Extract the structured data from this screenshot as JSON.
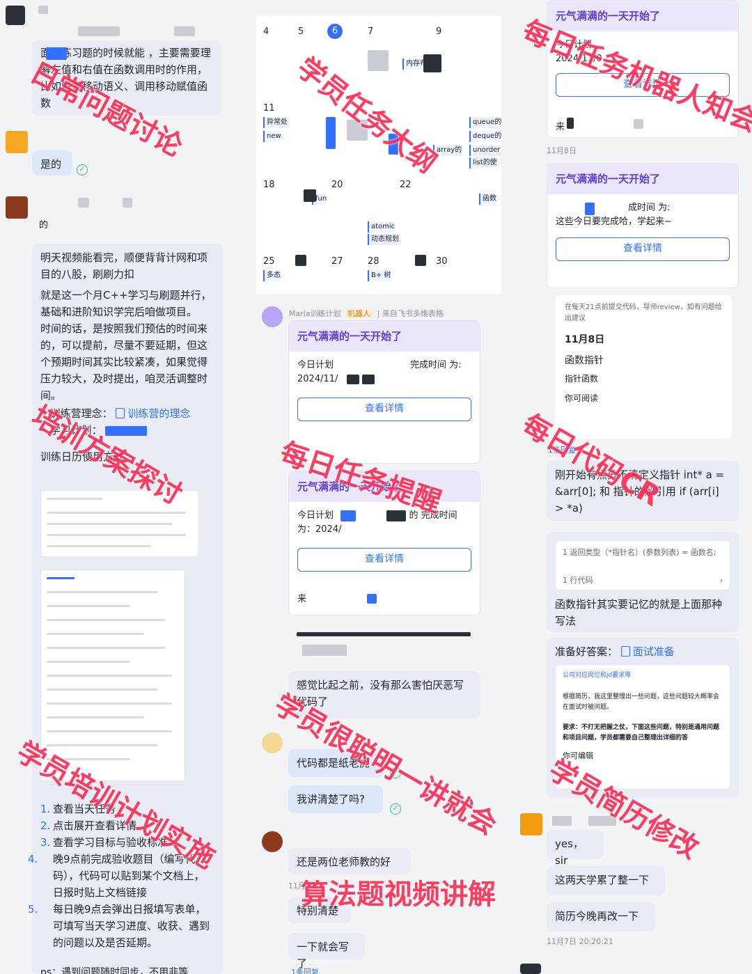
{
  "left": {
    "msg1": "面做练习题的时候就能 ，主要需要理解左值和右值在函数调用时的作用，比如触发移动语义、调用移动赋值函数",
    "msg2": "是的",
    "msg3_name": "的",
    "msg4_p1": "明天视频能看完，顺便背背计网和项目的八股，刷刷力扣",
    "msg4_p2": "就是这一个月C++学习与刷题并行，基础和进阶知识学完后咱做项目。",
    "msg4_p3": "时间的话，是按照我们预估的时间来的，可以提前，尽量不要延期，但这个预期时间其实比较紧凑，如果觉得压力较大，及时提出，咱灵活调整时间。",
    "bullet1_label": "训练营理念：",
    "bullet1_link": "训练营的理念",
    "bullet2_label": "学习计划：",
    "calendar_usage": "训练日历使用方式",
    "steps": [
      {
        "n": "1.",
        "text": "查看当天任务"
      },
      {
        "n": "2.",
        "text": "点击展开查看详情"
      },
      {
        "n": "3.",
        "text": "查看学习目标与验收标准"
      },
      {
        "n": "4.",
        "text": "晚9点前完成验收题目（编写代码），代码可以贴到某个文档上，日报时贴上文档链接"
      },
      {
        "n": "5.",
        "text": "每日晚9点会弹出日报填写表单，可填写当天学习进度、收获、遇到的问题以及是否延期。"
      }
    ],
    "footer": "ps：遇到问题随时同步，不用非等"
  },
  "calendar": {
    "days": [
      "4",
      "5",
      "6",
      "7",
      "9",
      "11",
      "18",
      "20",
      "22",
      "25",
      "27",
      "28",
      "30"
    ],
    "today": "6",
    "events": [
      "内存布",
      "queue的",
      "deque的",
      "unorder",
      "list的使",
      "异常处",
      "new",
      "array的",
      "fun",
      "atomic",
      "动态规划",
      "多态",
      "B+ 树",
      "函数"
    ]
  },
  "mid": {
    "bot_name": "Maria训练计划",
    "bot_tag": "机器人",
    "bot_source": "来自飞书多维表格",
    "card1_title": "元气满满的一天开始了",
    "card1_l1": "今日计划",
    "card1_l1b": "完成时间 为:",
    "card1_l2": "2024/11/",
    "card_btn": "查看详情",
    "card2_title": "元气满满的一天开始了",
    "card2_l1": "今日计划",
    "card2_l1b": "的 完成时间",
    "card2_l2": "为：2024/",
    "card2_l3": "来",
    "msg_a": "感觉比起之前，没有那么害怕厌恶写代码了",
    "msg_b": "代码都是纸老虎",
    "msg_c": "我讲清楚了吗?",
    "msg_d": "还是两位老师教的好",
    "msg_e": "特别清楚",
    "msg_f": "一下就会写了",
    "reply_count": "1条回复",
    "time_mid": "11月"
  },
  "right": {
    "card1_title": "元气满满的一天开始了",
    "card1_l1": "今日计划",
    "card1_l2": "2024/11/0",
    "card_btn": "查看详情",
    "card1_foot": "来",
    "time1": "11月8日",
    "card2_title": "元气满满的一天开始了",
    "card2_l1": "成时间 为:",
    "card2_l2": "这些今日要完成哈，学起来~",
    "doc_note": "在每天21点前提交代码，导师review，如有问题给出建议",
    "doc_date": "11月8日",
    "doc_h1": "函数指针",
    "doc_h2": "指针函数",
    "doc_read": "你可阅读",
    "reply": "1条回复",
    "msg_code": "刚开始有点分不清定义指针 int* a = &arr[0];   和  指针的解引用   if (arr[i] > *a)",
    "code_line": "1 返回类型（*指针名）(参数列表) = 函数名;",
    "code_foot": "1 行代码",
    "msg_fp": "函数指针其实要记忆的就是上面那种写法",
    "msg_prep": "准备好答案：",
    "prep_link": "面试准备",
    "resume_title": "公司对应岗位和jd要求等",
    "resume_p1": "根据简历，我这里整理出一些问题，这些问题较大概率会在面试时被问题。",
    "resume_p2": "要求：不打无把握之仗，下面这些问题，特别是通用问题和项目问题，学员都需要自己整理出详细的答",
    "resume_foot": "你可编辑",
    "msg_yes": "yes，sir",
    "msg_tired": "这两天学累了整一下",
    "msg_resume": "简历今晚再改一下",
    "time2": "11月7日 20:20:21"
  },
  "watermarks": [
    "日常问题讨论",
    "学员任务大纲",
    "每日任务机器人知会",
    "培训方案探讨",
    "每日任务提醒",
    "每日代码CR",
    "学员培训计划实施",
    "学员很聪明一讲就会",
    "学员简历修改",
    "算法题视频讲解"
  ],
  "colors": {
    "accent": "#3370ff",
    "watermark": "#ff2d55",
    "card_head": "#ebe6fb",
    "bubble": "#e9ecf4"
  }
}
